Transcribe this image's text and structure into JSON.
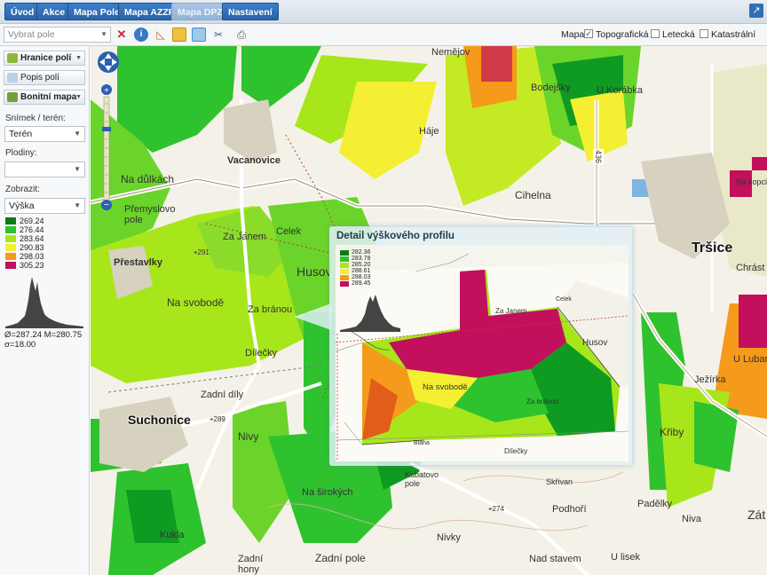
{
  "nav": {
    "buttons": [
      "Úvod",
      "Akce",
      "Mapa Pole",
      "Mapa AZZP",
      "Mapa DPZ",
      "Nastavení"
    ],
    "active_disabled": "Mapa DPZ",
    "external_icon": "external-link-icon"
  },
  "toolbar": {
    "field_select_placeholder": "Vybrat pole",
    "map_label": "Mapa:",
    "map_types": [
      {
        "label": "Topografická",
        "checked": true
      },
      {
        "label": "Letecká",
        "checked": false
      },
      {
        "label": "Katastrální",
        "checked": false
      }
    ],
    "icons": [
      "clear-icon",
      "info-icon",
      "measure-icon",
      "grid-icon",
      "layers-icon",
      "scissors-icon",
      "print-icon"
    ]
  },
  "sidebar": {
    "layers": [
      {
        "label": "Hranice polí",
        "icon": "field-border-icon"
      },
      {
        "label": "Popis polí",
        "icon": "field-label-icon"
      },
      {
        "label": "Bonitní mapa",
        "icon": "soil-map-icon"
      }
    ],
    "snimek_label": "Snímek / terén:",
    "snimek_value": "Terén",
    "plodiny_label": "Plodiny:",
    "plodiny_value": "",
    "zobrazit_label": "Zobrazit:",
    "zobrazit_value": "Výška",
    "legend": [
      {
        "value": "269.24",
        "color": "#0a7a16"
      },
      {
        "value": "276.44",
        "color": "#2fc22f"
      },
      {
        "value": "283.64",
        "color": "#a8e61c"
      },
      {
        "value": "290.83",
        "color": "#f4ef32"
      },
      {
        "value": "298.03",
        "color": "#f59a1a"
      },
      {
        "value": "305.23",
        "color": "#c2105d"
      }
    ],
    "stats_line1": "Ø=287.24 M=280.75",
    "stats_line2": "σ=18.00"
  },
  "map": {
    "labels": [
      {
        "text": "Nemějov"
      },
      {
        "text": "Bodejšky"
      },
      {
        "text": "U Korábka"
      },
      {
        "text": "Vacanovice"
      },
      {
        "text": "Na důlkách"
      },
      {
        "text": "Přemyslovo pole"
      },
      {
        "text": "Háje"
      },
      {
        "text": "Cihelna"
      },
      {
        "text": "Celek"
      },
      {
        "text": "Za Janem"
      },
      {
        "text": "Přestavlky"
      },
      {
        "text": "Na svobodě"
      },
      {
        "text": "Za bránou"
      },
      {
        "text": "Husov"
      },
      {
        "text": "Dílečky"
      },
      {
        "text": "Zadní díly"
      },
      {
        "text": "Suchonice"
      },
      {
        "text": "Nivy"
      },
      {
        "text": "Na širokých"
      },
      {
        "text": "Kukla"
      },
      {
        "text": "Zadní hony"
      },
      {
        "text": "Zadní pole"
      },
      {
        "text": "Nivky"
      },
      {
        "text": "Podhoří"
      },
      {
        "text": "Nad stavem"
      },
      {
        "text": "U lisek"
      },
      {
        "text": "Padělky"
      },
      {
        "text": "Niva"
      },
      {
        "text": "Křiby"
      },
      {
        "text": "Ježírka"
      },
      {
        "text": "U Lubana"
      },
      {
        "text": "Chrást"
      },
      {
        "text": "Tršice"
      },
      {
        "text": "Na kopci"
      },
      {
        "text": "Skřivan"
      },
      {
        "text": "Kubatovo pole"
      },
      {
        "text": "Zát"
      }
    ],
    "spot_heights": [
      "291",
      "289",
      "274"
    ],
    "road_number": "436"
  },
  "detail": {
    "title": "Detail výškového profilu",
    "legend": [
      {
        "value": "282.36",
        "color": "#0a7a16"
      },
      {
        "value": "283.78",
        "color": "#2fc22f"
      },
      {
        "value": "285.20",
        "color": "#a8e61c"
      },
      {
        "value": "288.61",
        "color": "#f4ef32"
      },
      {
        "value": "288.03",
        "color": "#f59a1a"
      },
      {
        "value": "289.45",
        "color": "#c2105d"
      }
    ],
    "labels": [
      "Na svobodě",
      "Za Janem",
      "Husov",
      "Za bránou",
      "Dílečky",
      "Blana",
      "Celek"
    ]
  }
}
